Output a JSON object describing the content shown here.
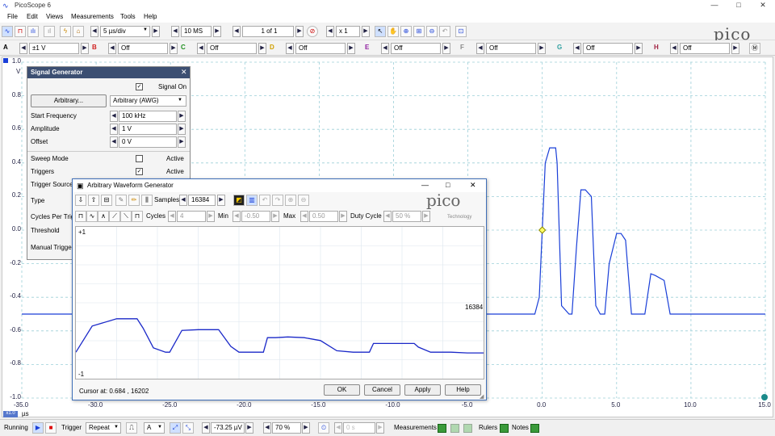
{
  "app": {
    "title": "PicoScope 6"
  },
  "window_controls": {
    "minimize": "—",
    "maximize": "□",
    "close": "✕"
  },
  "menu": [
    "File",
    "Edit",
    "Views",
    "Measurements",
    "Tools",
    "Help"
  ],
  "toolbar": {
    "timebase": "5 µs/div",
    "samples": "10 MS",
    "capture": "1 of 1",
    "zoom": "x 1",
    "logo": "pico"
  },
  "channels": [
    {
      "name": "A",
      "value": "±1 V",
      "color": "#1a3fd8"
    },
    {
      "name": "B",
      "value": "Off",
      "color": "#d02020"
    },
    {
      "name": "C",
      "value": "Off",
      "color": "#209020"
    },
    {
      "name": "D",
      "value": "Off",
      "color": "#d0a000"
    },
    {
      "name": "E",
      "value": "Off",
      "color": "#9020a0"
    },
    {
      "name": "F",
      "value": "Off",
      "color": "#888888"
    },
    {
      "name": "G",
      "value": "Off",
      "color": "#30a0a0"
    },
    {
      "name": "H",
      "value": "Off",
      "color": "#a02040"
    }
  ],
  "chart_data": {
    "type": "line",
    "ylabel": "V",
    "xlabel": "µs",
    "ylim": [
      -1.0,
      1.0
    ],
    "xlim": [
      -35,
      15
    ],
    "yticks": [
      "1.0",
      "0.8",
      "0.6",
      "0.4",
      "0.2",
      "0.0",
      "-0.2",
      "-0.4",
      "-0.6",
      "-0.8",
      "-1.0"
    ],
    "xticks": [
      "-35.0",
      "-30.0",
      "-25.0",
      "-20.0",
      "-15.0",
      "-10.0",
      "-5.0",
      "0.0",
      "5.0",
      "10.0",
      "15.0"
    ],
    "grid": true,
    "series": [
      {
        "x": [
          -35,
          -0.5,
          -0.2,
          0.2,
          0.5,
          0.9,
          1.0,
          1.3,
          1.8,
          2.0,
          2.3,
          2.6,
          2.9,
          3.3,
          3.6,
          3.9,
          4.2,
          4.5,
          5.0,
          5.3,
          5.6,
          6.0,
          6.5,
          6.9,
          7.3,
          7.6,
          8.2,
          8.6,
          9.0,
          9.4,
          15
        ],
        "y": [
          -0.5,
          -0.5,
          -0.4,
          0.4,
          0.49,
          0.49,
          0.4,
          -0.45,
          -0.5,
          -0.5,
          -0.1,
          0.24,
          0.24,
          0.2,
          -0.45,
          -0.5,
          -0.5,
          -0.2,
          -0.02,
          -0.02,
          -0.06,
          -0.5,
          -0.5,
          -0.5,
          -0.26,
          -0.27,
          -0.3,
          -0.5,
          -0.5,
          -0.5,
          -0.5
        ]
      }
    ]
  },
  "scope": {
    "bottom_tag": "x1.0",
    "xunit": "µs"
  },
  "signal_generator": {
    "title": "Signal Generator",
    "signal_on": "Signal On",
    "arbitrary_button": "Arbitrary...",
    "wave_type": "Arbitrary (AWG)",
    "start_frequency_label": "Start Frequency",
    "start_frequency": "100 kHz",
    "amplitude_label": "Amplitude",
    "amplitude": "1 V",
    "offset_label": "Offset",
    "offset": "0 V",
    "sweep_mode_label": "Sweep Mode",
    "triggers_label": "Triggers",
    "active": "Active",
    "trigger_source_label": "Trigger Source",
    "type_label": "Type",
    "cycles_per_trigger_label": "Cycles Per Trigg",
    "threshold_label": "Threshold",
    "manual_trigger_label": "Manual Trigger"
  },
  "awg": {
    "title": "Arbitrary Waveform Generator",
    "samples_label": "Samples",
    "samples": "16384",
    "cycles_label": "Cycles",
    "cycles": "4",
    "min_label": "Min",
    "min": "-0.50",
    "max_label": "Max",
    "max": "0.50",
    "duty_label": "Duty Cycle",
    "duty": "50 %",
    "y_top": "+1",
    "y_bottom": "-1",
    "sample_end": "16384",
    "cursor": "Cursor at: 0.684 , 16202",
    "ok": "OK",
    "cancel": "Cancel",
    "apply": "Apply",
    "help": "Help",
    "logo": "pico",
    "logo_sub": "Technology",
    "waveform": {
      "x": [
        0,
        40,
        100,
        150,
        165,
        190,
        220,
        230,
        260,
        300,
        330,
        350,
        380,
        400,
        440,
        460,
        470,
        490,
        520,
        560,
        600,
        640,
        680,
        720,
        730,
        760,
        790,
        830,
        840,
        870,
        890,
        920,
        960,
        1000
      ],
      "y": [
        -0.68,
        -0.32,
        -0.22,
        -0.22,
        -0.35,
        -0.62,
        -0.68,
        -0.68,
        -0.38,
        -0.37,
        -0.37,
        -0.37,
        -0.6,
        -0.68,
        -0.68,
        -0.68,
        -0.48,
        -0.48,
        -0.47,
        -0.48,
        -0.52,
        -0.66,
        -0.68,
        -0.68,
        -0.56,
        -0.56,
        -0.56,
        -0.56,
        -0.61,
        -0.68,
        -0.68,
        -0.68,
        -0.69,
        -0.69
      ]
    }
  },
  "status": {
    "running": "Running",
    "trigger_label": "Trigger",
    "trigger_mode": "Repeat",
    "trigger_channel": "A",
    "delay": "-73.25 µV",
    "pretrigger": "70 %",
    "post": "0 s",
    "measurements": "Measurements",
    "rulers": "Rulers",
    "notes": "Notes"
  }
}
